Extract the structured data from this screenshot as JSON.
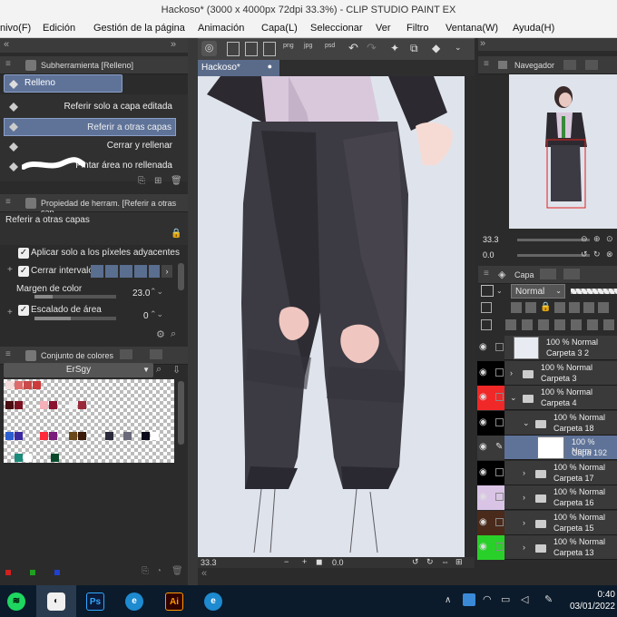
{
  "window": {
    "title": "Hackoso* (3000 x 4000px 72dpi 33.3%)  - CLIP STUDIO PAINT EX"
  },
  "menu": [
    "nivo(F)",
    "Edición",
    "Gestión de la página",
    "Animación",
    "Capa(L)",
    "Seleccionar",
    "Ver",
    "Filtro",
    "Ventana(W)",
    "Ayuda(H)"
  ],
  "subtool": {
    "header": "Subherramienta [Relleno]",
    "group": "Relleno",
    "items": [
      "Referir solo a capa editada",
      "Referir a otras capas",
      "Cerrar y rellenar",
      "Pintar área no rellenada"
    ],
    "selected_index": 1
  },
  "toolprop": {
    "header": "Propiedad de herram. [Referir a otras cap",
    "name": "Referir a otras capas",
    "adjacent_label": "Aplicar solo a los píxeles adyacentes",
    "close_gap_label": "Cerrar intervalo",
    "color_margin_label": "Margen de color",
    "color_margin_value": "23.0",
    "area_scale_label": "Escalado de área",
    "area_scale_value": "0"
  },
  "colorset": {
    "header": "Conjunto de colores",
    "set_name": "ErSgy",
    "colors": [
      "#f2dcdc",
      "#e06b6b",
      "#c94a4a",
      "#cc3a3a",
      "#4a0d10",
      "#7a1020",
      "#f5b0b8",
      "#8a1530",
      "#f0f0f0",
      "#9a2a3a",
      "#2a5fd0",
      "#3a2aa0",
      "#ff2a3a",
      "#7a1a7a",
      "#6a4a1a",
      "#3a1a0a",
      "#2a2a3a",
      "#6a6a7a",
      "#0a0a1a",
      "#ffffff",
      "#1a8a7a",
      "#ffffff",
      "#0a4a2a"
    ]
  },
  "document": {
    "tab": "Hackoso*",
    "zoom": "33.3",
    "angle": "0.0"
  },
  "navigator": {
    "header": "Navegador",
    "zoom": "33.3",
    "angle": "0.0"
  },
  "layers": {
    "tab": "Capa",
    "blend_mode": "Normal",
    "rows": [
      {
        "line1": "100 % Normal",
        "line2": "Carpeta 3 2",
        "swatch": "#2b2b2b",
        "thumb": true,
        "folder": false
      },
      {
        "line1": "100 % Normal",
        "line2": "Carpeta 3",
        "swatch": "#000000",
        "thumb": false,
        "folder": true
      },
      {
        "line1": "100 % Normal",
        "line2": "Carpeta 4",
        "swatch": "#f02828",
        "thumb": false,
        "folder": true
      },
      {
        "line1": "100 % Normal",
        "line2": "Carpeta 18",
        "swatch": "#000000",
        "thumb": false,
        "folder": true
      },
      {
        "line1": "100 % Norm",
        "line2": "Capa 192",
        "swatch": "#3a3a3a",
        "thumb": true,
        "folder": false,
        "selected": true
      },
      {
        "line1": "100 % Normal",
        "line2": "Carpeta 17",
        "swatch": "#000000",
        "thumb": false,
        "folder": true
      },
      {
        "line1": "100 % Normal",
        "line2": "Carpeta 16",
        "swatch": "#d9c4e6",
        "thumb": false,
        "folder": true
      },
      {
        "line1": "100 % Normal",
        "line2": "Carpeta 15",
        "swatch": "#4a2a1a",
        "thumb": false,
        "folder": true
      },
      {
        "line1": "100 % Normal",
        "line2": "Carpeta 13",
        "swatch": "#2ad02a",
        "thumb": false,
        "folder": true
      }
    ]
  },
  "taskbar": {
    "time": "0:40",
    "date": "03/01/2022",
    "apps": [
      "spotify-icon",
      "clipstudio-icon",
      "photoshop-icon",
      "edge-icon",
      "illustrator-icon",
      "edge-dev-icon"
    ],
    "ps": "Ps",
    "ai": "Ai"
  }
}
